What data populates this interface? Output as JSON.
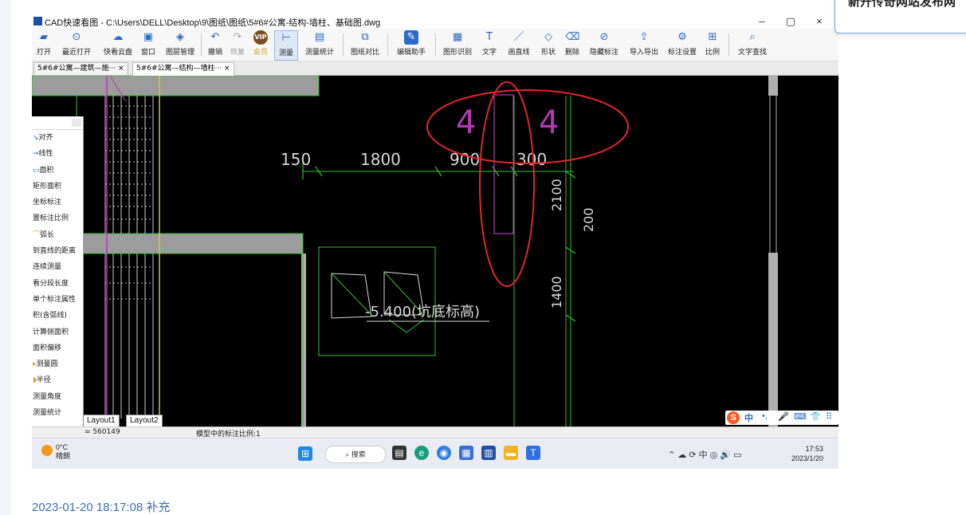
{
  "window": {
    "title": "CAD快速看图 - C:\\Users\\DELL\\Desktop\\9\\图纸\\图纸\\5#6#公寓-结构-墙柱、基础图.dwg",
    "min": "–",
    "max": "▢",
    "close": "×"
  },
  "toolbar": [
    {
      "name": "open",
      "label": "打开",
      "icon": "▰"
    },
    {
      "name": "recent",
      "label": "最近打开",
      "icon": "⊙"
    },
    {
      "name": "cloud",
      "label": "快看云盘",
      "icon": "☁"
    },
    {
      "name": "window",
      "label": "窗口",
      "icon": "▣"
    },
    {
      "name": "layers",
      "label": "图层管理",
      "icon": "◈"
    },
    {
      "name": "undo",
      "label": "撤销",
      "icon": "↶"
    },
    {
      "name": "redo",
      "label": "恢复",
      "icon": "↷"
    },
    {
      "name": "vip",
      "label": "会员",
      "icon": "VIP"
    },
    {
      "name": "measure",
      "label": "测量",
      "icon": "⊢"
    },
    {
      "name": "measure-stats",
      "label": "测量统计",
      "icon": "▤"
    },
    {
      "name": "compare",
      "label": "图纸对比",
      "icon": "⧉"
    },
    {
      "name": "edit-helper",
      "label": "编辑助手",
      "icon": "✎"
    },
    {
      "name": "shape-recog",
      "label": "图形识别",
      "icon": "▦"
    },
    {
      "name": "text",
      "label": "文字",
      "icon": "T"
    },
    {
      "name": "line",
      "label": "画直线",
      "icon": "／"
    },
    {
      "name": "shape",
      "label": "形状",
      "icon": "◇"
    },
    {
      "name": "delete",
      "label": "删除",
      "icon": "⌫"
    },
    {
      "name": "hide-marks",
      "label": "隐藏标注",
      "icon": "⊘"
    },
    {
      "name": "import-export",
      "label": "导入导出",
      "icon": "⇪"
    },
    {
      "name": "mark-settings",
      "label": "标注设置",
      "icon": "⚙"
    },
    {
      "name": "scale",
      "label": "比例",
      "icon": "⊞"
    },
    {
      "name": "text-search",
      "label": "文字查找",
      "icon": "⌕"
    }
  ],
  "tabs": [
    {
      "label": "5#6#公寓—建筑—施··· ×"
    },
    {
      "label": "5#6#公寓—结构—墙柱··· ×"
    }
  ],
  "panel": [
    "对齐",
    "线性",
    "面积",
    "矩形面积",
    "坐标标注",
    "置标注比例",
    "弧长",
    "到直线的距离",
    "连续测量",
    "看分段长度",
    "单个标注属性",
    "积(含弧线)",
    "计算侧面积",
    "面积偏移",
    "测量圆",
    "半径",
    "测量角度",
    "测量统计"
  ],
  "drawing": {
    "dims": [
      "150",
      "1800",
      "900",
      "300",
      "2100",
      "200",
      "1400"
    ],
    "label": "-5.400(坑底标高)",
    "marks": [
      "4",
      "4"
    ]
  },
  "layouts": [
    "Layout1",
    "Layout2"
  ],
  "status": {
    "coord": "= 560149",
    "scale": "模型中的标注比例:1"
  },
  "ime": {
    "logo": "S",
    "mode": "中",
    "punct": "•,",
    "mic": "🎤",
    "kb": "⌨",
    "skin": "👕",
    "grid": "⠿"
  },
  "taskbar": {
    "temp": "0°C",
    "weather": "晴朗",
    "search": "搜索",
    "time": "17:53",
    "date": "2023/1/20"
  },
  "popup": {
    "text": "新开传奇网站发布网"
  },
  "timestamp": "2023-01-20 18:17:08 补充",
  "colors": {
    "canvas": "#000000",
    "green": "#2fc12f",
    "magenta": "#b33ab3",
    "white": "#d8d8d8",
    "red": "#e3262a",
    "accent": "#2a6ac8"
  }
}
